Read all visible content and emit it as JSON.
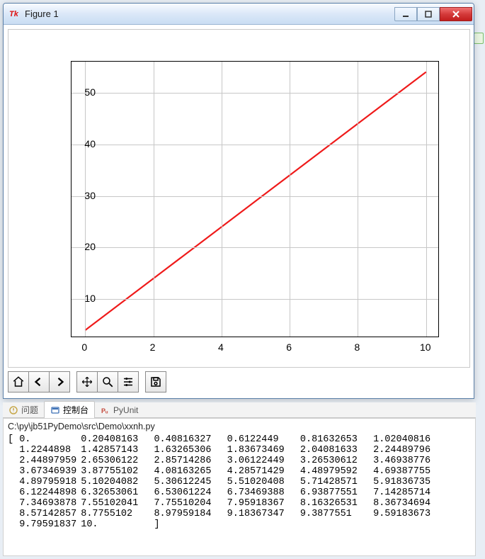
{
  "window": {
    "title": "Figure 1",
    "min_label": "minimize",
    "max_label": "maximize",
    "close_label": "close"
  },
  "toolbar": {
    "home": "home",
    "back": "back",
    "forward": "forward",
    "pan": "pan",
    "zoom": "zoom",
    "config": "configure-subplots",
    "save": "save"
  },
  "chart_data": {
    "type": "line",
    "x": [
      0,
      10
    ],
    "y": [
      4,
      54
    ],
    "xlabel": "",
    "ylabel": "",
    "title": "",
    "xlim": [
      -0.4,
      10.4
    ],
    "ylim": [
      2.5,
      56
    ],
    "xticks": [
      0,
      2,
      4,
      6,
      8,
      10
    ],
    "yticks": [
      10,
      20,
      30,
      40,
      50
    ],
    "grid": true,
    "color": "#ef1a1a"
  },
  "ide_tabs": {
    "problems": "问题",
    "console": "控制台",
    "pyunit": "PyUnit"
  },
  "console": {
    "path": "C:\\py\\jb51PyDemo\\src\\Demo\\xxnh.py",
    "open": "[",
    "close": "]",
    "values": [
      "0.",
      "0.20408163",
      "0.40816327",
      "0.6122449",
      "0.81632653",
      "1.02040816",
      "1.2244898",
      "1.42857143",
      "1.63265306",
      "1.83673469",
      "2.04081633",
      "2.24489796",
      "2.44897959",
      "2.65306122",
      "2.85714286",
      "3.06122449",
      "3.26530612",
      "3.46938776",
      "3.67346939",
      "3.87755102",
      "4.08163265",
      "4.28571429",
      "4.48979592",
      "4.69387755",
      "4.89795918",
      "5.10204082",
      "5.30612245",
      "5.51020408",
      "5.71428571",
      "5.91836735",
      "6.12244898",
      "6.32653061",
      "6.53061224",
      "6.73469388",
      "6.93877551",
      "7.14285714",
      "7.34693878",
      "7.55102041",
      "7.75510204",
      "7.95918367",
      "8.16326531",
      "8.36734694",
      "8.57142857",
      "8.7755102",
      "8.97959184",
      "9.18367347",
      "9.3877551",
      "9.59183673",
      "9.79591837",
      "10."
    ],
    "cols": 6
  }
}
